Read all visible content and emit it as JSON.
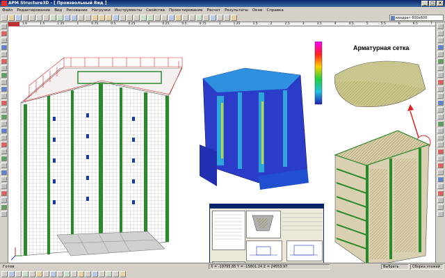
{
  "window": {
    "title": "APM Structure3D - [ Произвольный Вид ]"
  },
  "menu": {
    "items": [
      "Файл",
      "Редактирование",
      "Вид",
      "Рисование",
      "Нагрузки",
      "Инструменты",
      "Свойства",
      "Проектирование",
      "Расчет",
      "Результаты",
      "Окно",
      "Справка"
    ]
  },
  "toolbar": {
    "section_select_value": "квадрат 600х600"
  },
  "ruler": {
    "ticks": [
      "1.6",
      "1.5",
      "1.25",
      "1",
      "0.75",
      "0.5",
      "0.25",
      "0",
      "0.25",
      "0.5",
      "0.75",
      "1",
      "1.25",
      "1.5",
      "2",
      "2.5",
      "3",
      "3.5",
      "4",
      "4.5",
      "5",
      "5.5",
      "6",
      "6.5",
      "7"
    ]
  },
  "annotation": {
    "rebar_mesh_label": "Арматурная сетка"
  },
  "status": {
    "ready": "Готов",
    "coords": "X = -19795.85 Y = -15801.24 Z = 24553.97",
    "mode": "Выбрать",
    "floor_assembly": "Сборка этажей"
  },
  "colors": {
    "title_bar": "#0a246a",
    "frame_red": "#e02020",
    "column_green": "#2a8a2a",
    "stress_blue": "#2030c0"
  }
}
